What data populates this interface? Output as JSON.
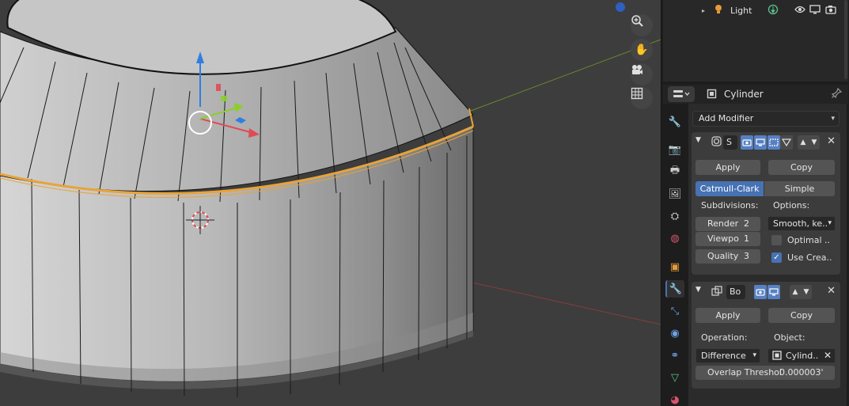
{
  "outliner": {
    "row_label": "Light"
  },
  "properties_header": {
    "object_name": "Cylinder"
  },
  "add_modifier": {
    "label": "Add Modifier"
  },
  "subsurf": {
    "name_short": "S",
    "apply_label": "Apply",
    "copy_label": "Copy",
    "mode_on": "Catmull-Clark",
    "mode_off": "Simple",
    "subdivisions_label": "Subdivisions:",
    "options_label": "Options:",
    "render_label": "Render",
    "render_value": "2",
    "viewport_label": "Viewpo",
    "viewport_value": "1",
    "quality_label": "Quality",
    "quality_value": "3",
    "uv_smooth_value": "Smooth, ke..",
    "optimal_label": "Optimal ..",
    "use_crease_label": "Use Crea.."
  },
  "boolean": {
    "name_short": "Bo",
    "apply_label": "Apply",
    "copy_label": "Copy",
    "operation_label": "Operation:",
    "object_label": "Object:",
    "operation_value": "Difference",
    "object_value": "Cylind..",
    "overlap_label": "Overlap Threshol",
    "overlap_value": "0.000003'"
  },
  "colors": {
    "selection_edge": "#e8a33a",
    "accent": "#4772b3",
    "axis_x": "#b5454e",
    "axis_y": "#7fa12f"
  }
}
